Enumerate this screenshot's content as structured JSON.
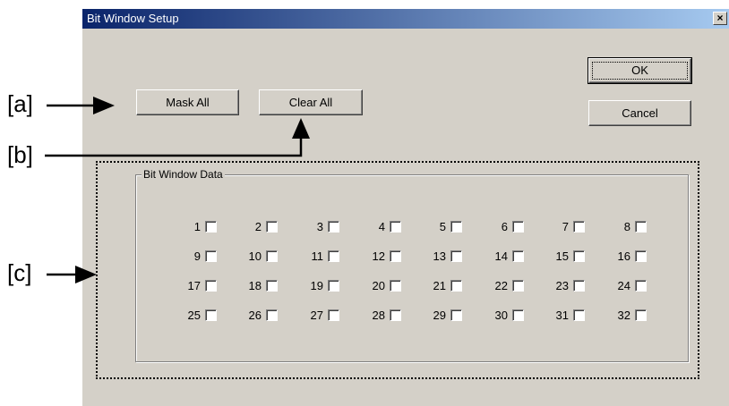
{
  "callouts": {
    "a": "[a]",
    "b": "[b]",
    "c": "[c]"
  },
  "dialog": {
    "title": "Bit Window Setup",
    "close_glyph": "×"
  },
  "buttons": {
    "mask_all": "Mask All",
    "clear_all": "Clear All",
    "ok": "OK",
    "cancel": "Cancel"
  },
  "group": {
    "label": "Bit Window Data",
    "bits": [
      "1",
      "2",
      "3",
      "4",
      "5",
      "6",
      "7",
      "8",
      "9",
      "10",
      "11",
      "12",
      "13",
      "14",
      "15",
      "16",
      "17",
      "18",
      "19",
      "20",
      "21",
      "22",
      "23",
      "24",
      "25",
      "26",
      "27",
      "28",
      "29",
      "30",
      "31",
      "32"
    ],
    "checked": []
  },
  "colors": {
    "dialog_bg": "#d4d0c8",
    "title_start": "#0a246a",
    "title_end": "#a6caf0"
  }
}
